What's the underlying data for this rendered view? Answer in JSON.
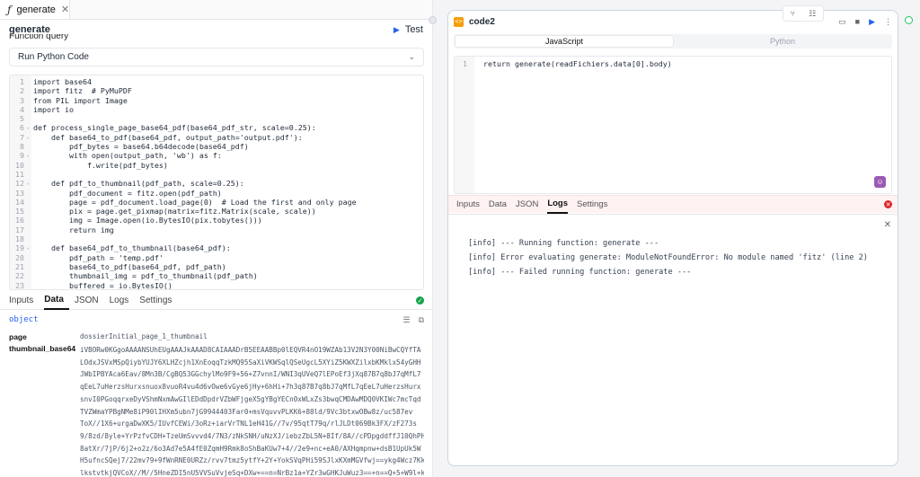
{
  "left_panel": {
    "tab": {
      "icon": "function-icon",
      "label": "generate",
      "close": "✕"
    },
    "header": {
      "name": "generate",
      "test_label": "Test"
    },
    "field_label": "Function query",
    "language_select": "Run Python Code",
    "code_lines": [
      "import base64",
      "import fitz  # PyMuPDF",
      "from PIL import Image",
      "import io",
      "",
      "def process_single_page_base64_pdf(base64_pdf_str, scale=0.25):",
      "    def base64_to_pdf(base64_pdf, output_path='output.pdf'):",
      "        pdf_bytes = base64.b64decode(base64_pdf)",
      "        with open(output_path, 'wb') as f:",
      "            f.write(pdf_bytes)",
      "",
      "    def pdf_to_thumbnail(pdf_path, scale=0.25):",
      "        pdf_document = fitz.open(pdf_path)",
      "        page = pdf_document.load_page(0)  # Load the first and only page",
      "        pix = page.get_pixmap(matrix=fitz.Matrix(scale, scale))",
      "        img = Image.open(io.BytesIO(pix.tobytes()))",
      "        return img",
      "",
      "    def base64_pdf_to_thumbnail(base64_pdf):",
      "        pdf_path = 'temp.pdf'",
      "        base64_to_pdf(base64_pdf, pdf_path)",
      "        thumbnail_img = pdf_to_thumbnail(pdf_path)",
      "        buffered = io.BytesIO()"
    ],
    "fold_lines": [
      6,
      7,
      9,
      12,
      19
    ],
    "data_tabs": [
      "Inputs",
      "Data",
      "JSON",
      "Logs",
      "Settings"
    ],
    "data_tab_active": "Data",
    "data_type": "object",
    "page_key": "page",
    "page_value": "dossierInitial_page_1_thumbnail",
    "thumb_key": "thumbnail_base64",
    "thumb_lines": [
      "iVBORw0KGgoAAAANSUhEUgAAAJkAAAD8CAIAAADrB5EEAABBp0lEQVR4nO19WZAb13V2N3Y00NiBwCQYfTA",
      "LOdxJSVxMSpQiybYUJY6XLHZcjh1XnEoqqTzkMQ95SaXiVKWSqlQSeUgcL5XYiZ5KWXZilxbKMklx54yGHH",
      "JWbIPBYAca6Eav/8Mn3B/CgBQ53GGchylMo9F9+56+Z7vnnI/WNI3qUVeQ7lEPoEf3jXq87B7q8bJ7qMfL7",
      "qEeL7uHerzsHurxsnuox8vuoR4vu4d6vOwe6vGye6jHy+6hHi+7h3q87B7q8bJ7qMfL7qEeL7uHerzsHurx",
      "snvI0PGoqqrxeDyVShmNxmAwGIlEDdDpdrVZbWFjgeX5gYBgYECn0xWLxZs3bwqCMDAwMDQ0VKIWc7mcTqd",
      "TVZWmaYPBgNMe8iP90lIHXm5ubn7jG9944403Far0+msVquvvPLKK6+88ld/9Vc3btxwOBw8z/uc587ev",
      "ToX//1X6+urgaDwXK5/IUvfCEWi/3oRz+iarVrTNL1eH41G//7v/95qtT79q/rlJLDt069Bk3FX/zF273s",
      "9/8zd/8yle+YrPzfvCDH+TzeUmSvvvd4/7N3/zNkSNH/uNzXJ/iebzZbL5N+8If/8A//cPDpgddffJ10QhPHx",
      "8atXr/7jP/6j2+o2z/6o3Ad7e5A4fE0ZqmH9Rmk8oShBaKUw7+4//2e9+nc+eA0/AXHqmpnw+dsB1UpUk5W",
      "H5ufncSQej7/22mv79+9fWnRNE0URZz/rvv7tmz5ytfY+2Y+YokSVqPHi59SJlxKXmMGVfwj==ykg4Wcz7Kk",
      "lkstvtkjQVCoX//M//5HneZDI5nU5VVSuVvjeSq+DXw+==n=NrBz1a+YZr3wGHKJuWuz3==+n==Q+5+W9l+k"
    ]
  },
  "node": {
    "title": "code2",
    "icon": "code-icon",
    "languages": [
      "JavaScript",
      "Python"
    ],
    "language_active": "JavaScript",
    "code_lines": [
      "return generate(readFichiers.data[0].body)"
    ],
    "tabs": [
      "Inputs",
      "Data",
      "JSON",
      "Logs",
      "Settings"
    ],
    "tab_active": "Logs",
    "logs": [
      "[info] --- Running function: generate ---",
      "[info] Error evaluating generate: ModuleNotFoundError: No module named 'fitz' (line 2)",
      "[info] --- Failed running function: generate ---"
    ]
  }
}
